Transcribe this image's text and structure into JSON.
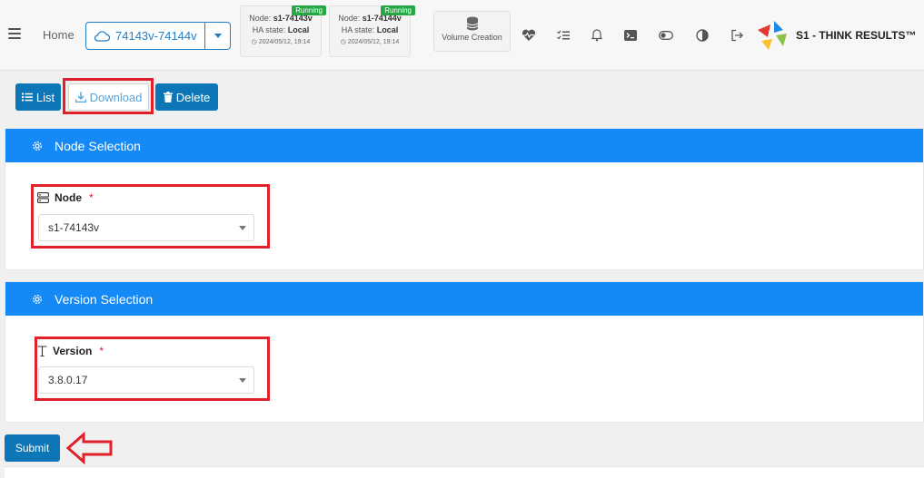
{
  "topbar": {
    "home_label": "Home",
    "cluster": "74143v-74144v",
    "nodes": [
      {
        "prefix": "Node: ",
        "name": "s1-74143v",
        "ha_prefix": "HA state: ",
        "ha_state": "Local",
        "timestamp": "2024/05/12, 19:14",
        "status": "Running"
      },
      {
        "prefix": "Node: ",
        "name": "s1-74144v",
        "ha_prefix": "HA state: ",
        "ha_state": "Local",
        "timestamp": "2024/05/12, 19:14",
        "status": "Running"
      }
    ],
    "volume_creation": "Volume Creation",
    "icons": [
      "heartbeat-icon",
      "checklist-icon",
      "bell-icon",
      "terminal-icon",
      "toggle-icon",
      "contrast-icon",
      "logout-icon"
    ],
    "brand": "S1 - THINK RESULTS™"
  },
  "actions": {
    "list_label": "List",
    "download_label": "Download",
    "delete_label": "Delete"
  },
  "node_selection": {
    "title": "Node Selection",
    "label": "Node",
    "required": "*",
    "value": "s1-74143v"
  },
  "version_selection": {
    "title": "Version Selection",
    "label": "Version",
    "required": "*",
    "value": "3.8.0.17"
  },
  "submit_label": "Submit",
  "colors": {
    "primary": "#1589f5",
    "button": "#0d76b6",
    "highlight": "#e0202a",
    "running": "#26a745"
  }
}
